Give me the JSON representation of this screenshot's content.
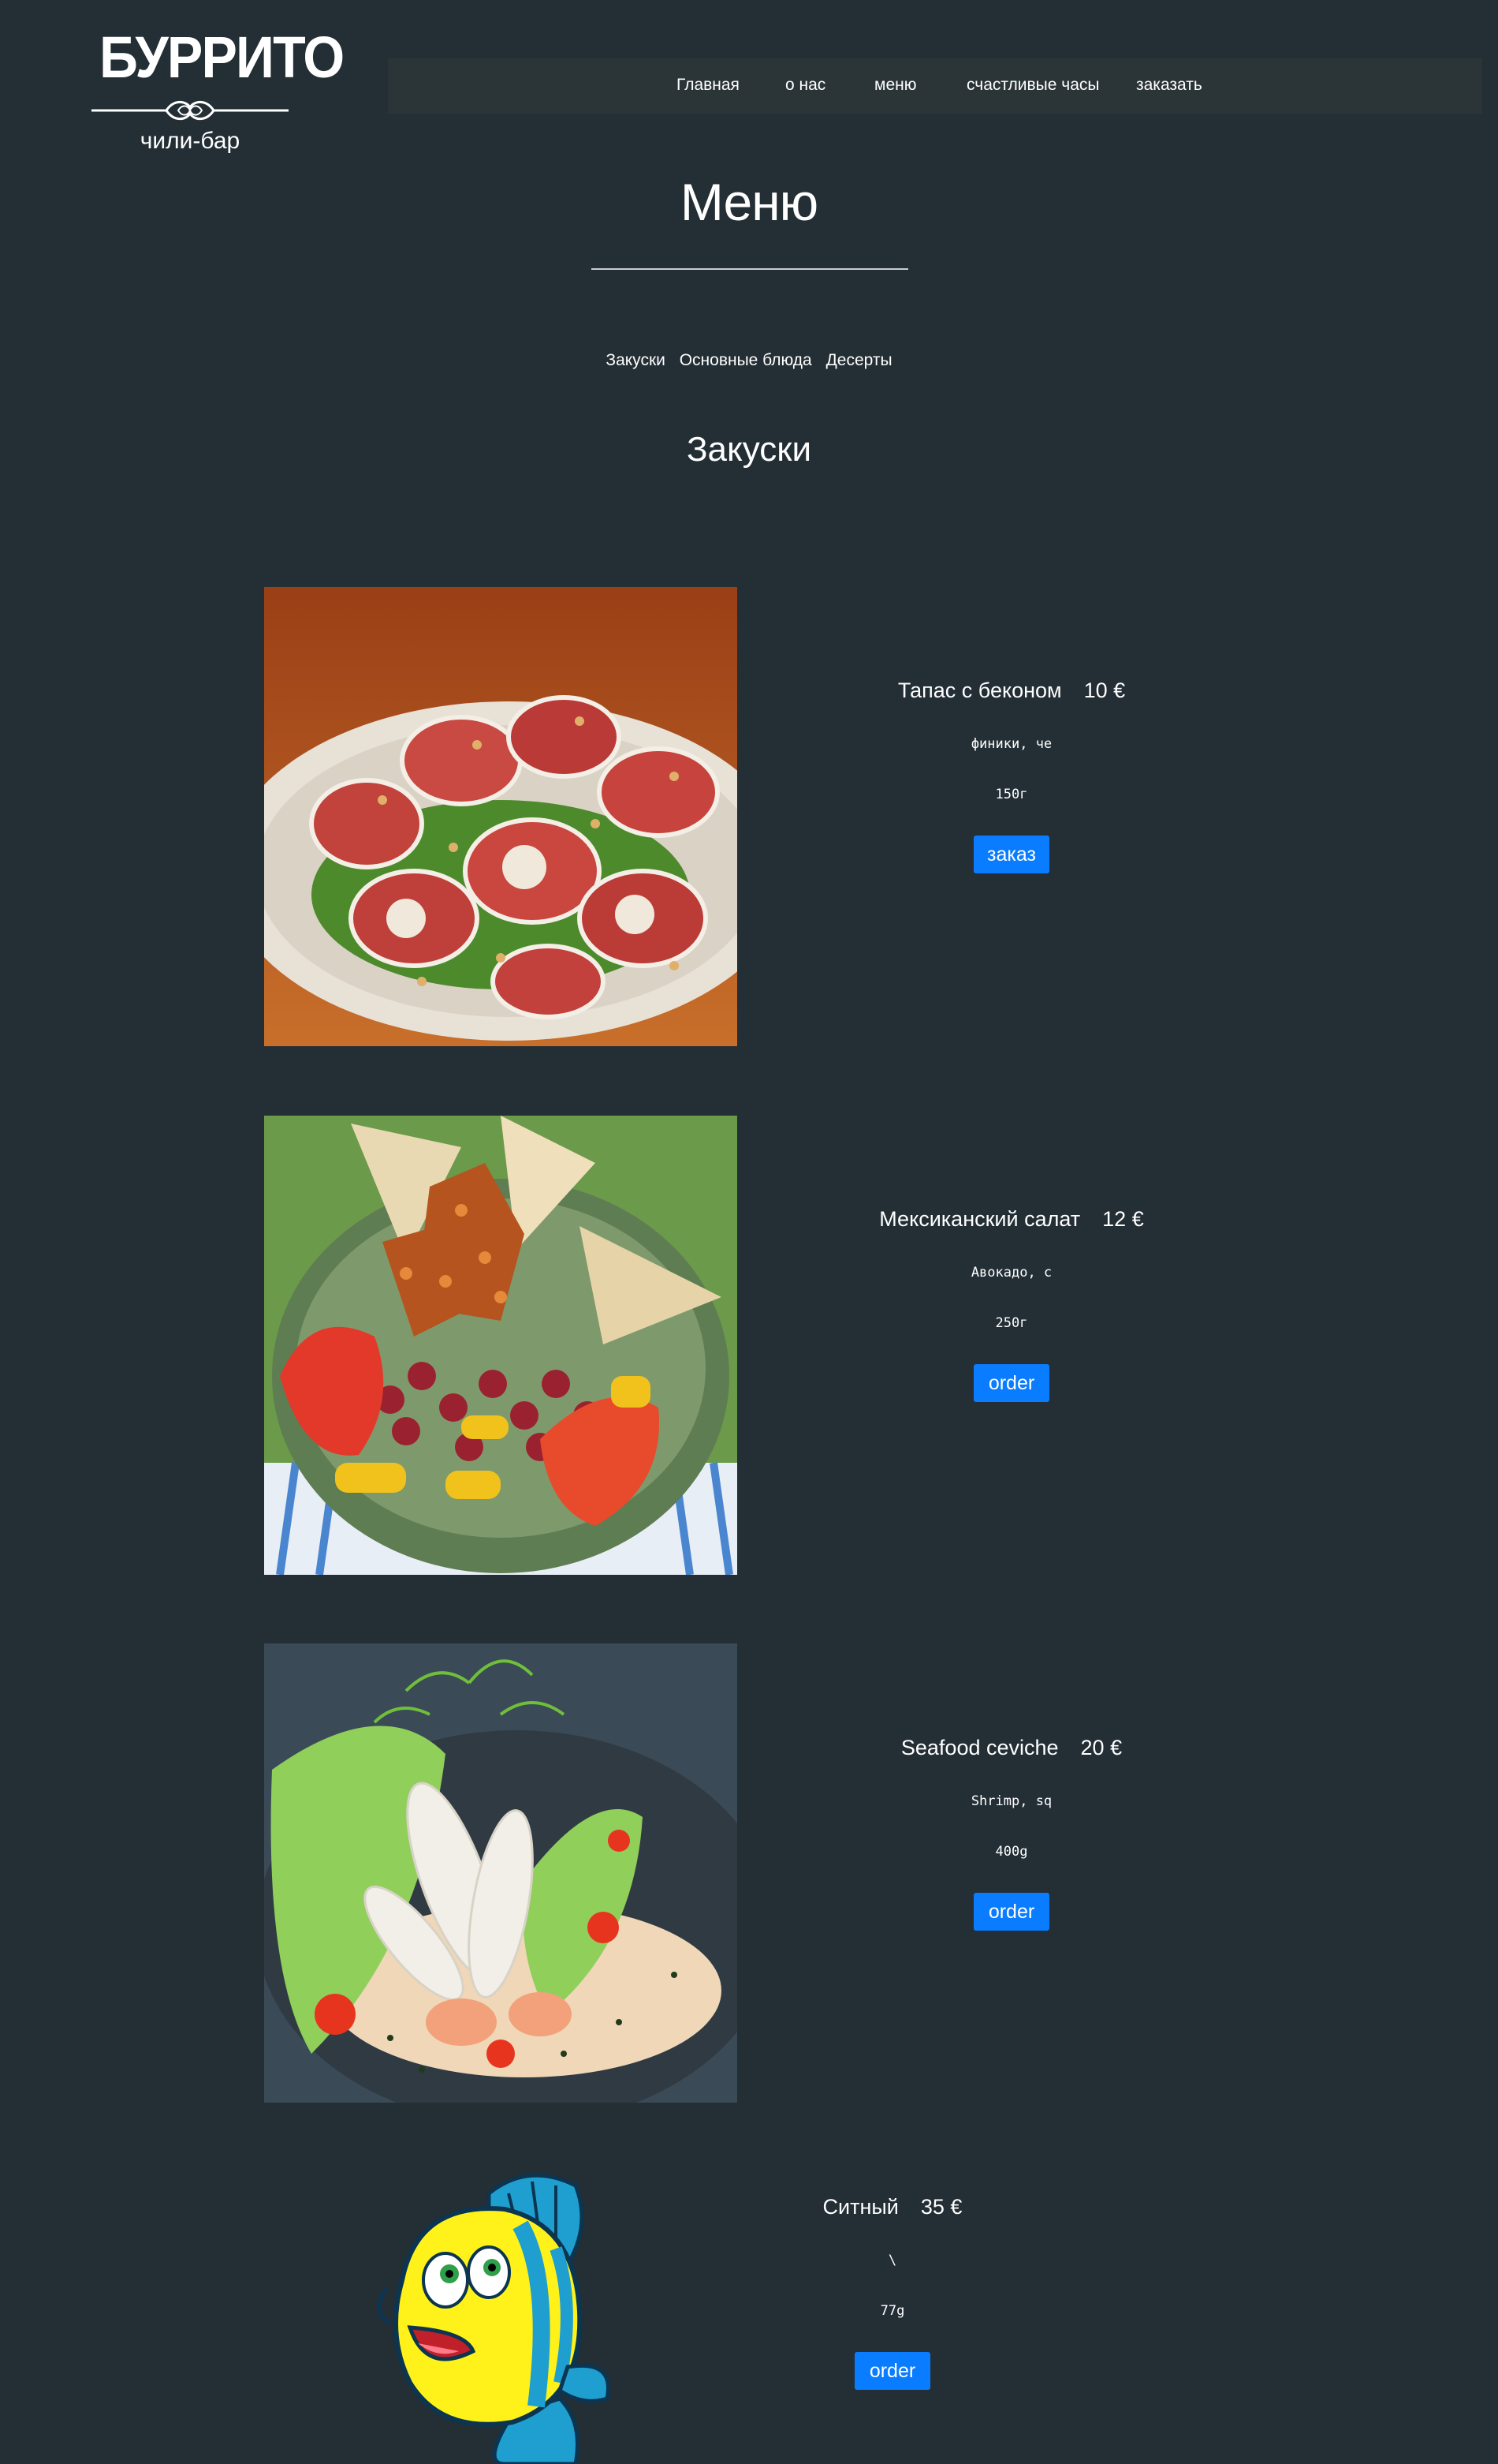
{
  "logo": {
    "title": "БУРРИТО",
    "subtitle": "чили-бар"
  },
  "nav": [
    {
      "label": "Главная"
    },
    {
      "label": "о нас"
    },
    {
      "label": "меню"
    },
    {
      "label": "счастливые часы"
    },
    {
      "label": "заказать"
    }
  ],
  "page_title": "Меню",
  "categories": [
    "Закуски",
    "Основные блюда",
    "Десерты"
  ],
  "section_title": "Закуски",
  "dishes": [
    {
      "name": "Тапас с беконом",
      "price": "10 €",
      "description": "финики, че",
      "weight": "150г",
      "button": "заказ",
      "image": "bacon-rolls-photo"
    },
    {
      "name": "Мексиканский салат",
      "price": "12 €",
      "description": "Авокадо, с",
      "weight": "250г",
      "button": "order",
      "image": "mexican-salad-photo"
    },
    {
      "name": "Seafood ceviche",
      "price": "20 €",
      "description": "Shrimp, sq",
      "weight": "400g",
      "button": "order",
      "image": "ceviche-photo"
    },
    {
      "name": "Ситный",
      "price": "35 €",
      "description": "\\",
      "weight": "77g",
      "button": "order",
      "image": "cartoon-fish-image"
    }
  ],
  "colors": {
    "background": "#232e35",
    "navbar": "#2b3538",
    "button": "#0a7cff"
  }
}
